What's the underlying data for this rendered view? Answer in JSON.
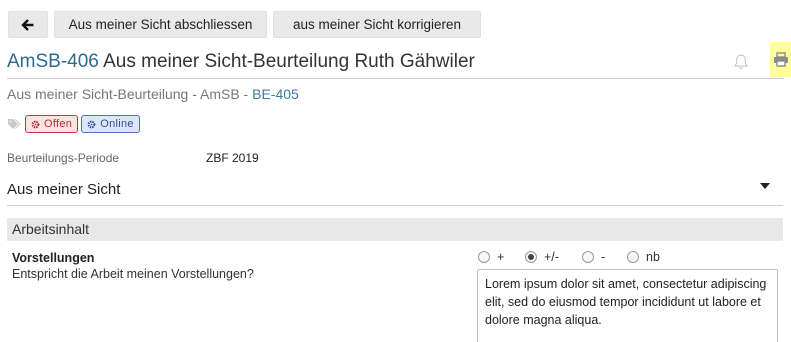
{
  "toolbar": {
    "back_icon": "arrow-left-icon",
    "btn_close": "Aus meiner Sicht abschliessen",
    "btn_correct": "aus meiner Sicht korrigieren"
  },
  "header": {
    "id": "AmSB-406",
    "title": "Aus meiner Sicht-Beurteilung Ruth Gähwiler",
    "bell_icon": "bell-icon",
    "print_icon": "printer-icon",
    "print_highlight": "#ffff99"
  },
  "subtitle": {
    "text": "Aus meiner Sicht-Beurteilung - AmSB - ",
    "link": "BE-405"
  },
  "tags": {
    "icon": "tag-icon",
    "items": [
      {
        "label": "Offen",
        "icon": "gear-icon",
        "color": "#c43a3a"
      },
      {
        "label": "Online",
        "icon": "gear-icon",
        "color": "#4b6fc2"
      }
    ]
  },
  "period": {
    "label": "Beurteilungs-Periode",
    "value": "ZBF 2019"
  },
  "section_select": {
    "value": "Aus meiner Sicht",
    "icon": "caret-down-icon"
  },
  "group": {
    "title": "Arbeitsinhalt"
  },
  "question": {
    "title": "Vorstellungen",
    "description": "Entspricht die Arbeit meinen Vorstellungen?",
    "options": [
      "+",
      "+/-",
      "-",
      "nb"
    ],
    "selected": "+/-",
    "comment": "Lorem ipsum dolor sit amet, consectetur adipiscing elit, sed do eiusmod tempor incididunt ut labore et dolore magna aliqua."
  }
}
